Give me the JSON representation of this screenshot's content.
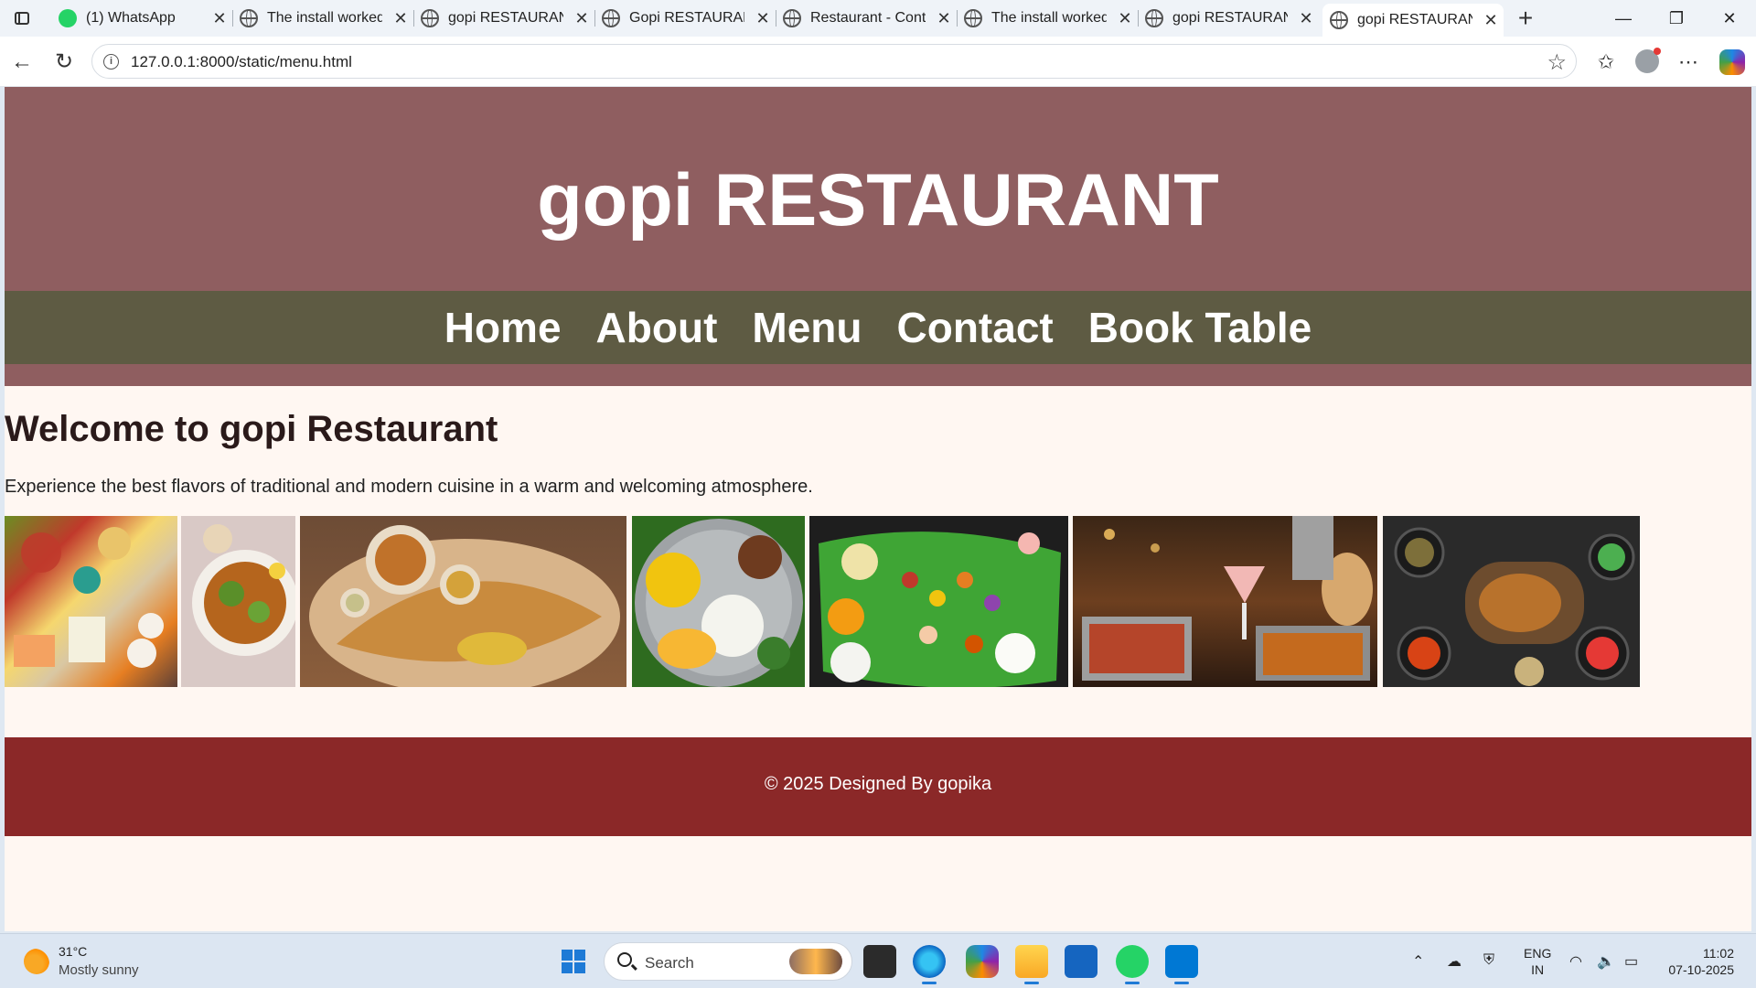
{
  "browser": {
    "tabs": [
      {
        "title": "(1) WhatsApp",
        "icon": "whatsapp-icon",
        "active": false
      },
      {
        "title": "The install worked",
        "icon": "globe-icon",
        "active": false
      },
      {
        "title": "gopi RESTAURANT",
        "icon": "globe-icon",
        "active": false
      },
      {
        "title": "Gopi RESTAURANT",
        "icon": "globe-icon",
        "active": false
      },
      {
        "title": "Restaurant - Contact",
        "icon": "globe-icon",
        "active": false
      },
      {
        "title": "The install worked",
        "icon": "globe-icon",
        "active": false
      },
      {
        "title": "gopi RESTAURANT",
        "icon": "globe-icon",
        "active": false
      },
      {
        "title": "gopi RESTAURANT",
        "icon": "globe-icon",
        "active": true
      }
    ],
    "close_glyph": "✕",
    "new_tab_glyph": "+",
    "window_controls": {
      "minimize": "—",
      "restore": "❐",
      "close": "✕"
    },
    "url": "127.0.0.1:8000/static/menu.html"
  },
  "page": {
    "site_title": "gopi RESTAURANT",
    "nav": [
      "Home",
      "About",
      "Menu",
      "Contact",
      "Book Table"
    ],
    "welcome_heading": "Welcome to gopi Restaurant",
    "tagline": "Experience the best flavors of traditional and modern cuisine in a warm and welcoming atmosphere.",
    "gallery": [
      {
        "name": "ingredients-image"
      },
      {
        "name": "grilled-chicken-salad-image"
      },
      {
        "name": "masala-dosa-image"
      },
      {
        "name": "south-indian-thali-image"
      },
      {
        "name": "banana-leaf-meal-image"
      },
      {
        "name": "restaurant-feast-image"
      },
      {
        "name": "roast-chicken-spread-image"
      }
    ],
    "footer": "© 2025 Designed By gopika"
  },
  "taskbar": {
    "weather_temp": "31°C",
    "weather_desc": "Mostly sunny",
    "search_placeholder": "Search",
    "lang_line1": "ENG",
    "lang_line2": "IN",
    "time": "11:02",
    "date": "07-10-2025"
  },
  "colors": {
    "header": "#8f5e60",
    "nav": "#5e5b43",
    "footer": "#8b2828",
    "page_bg": "#fff7f2"
  }
}
